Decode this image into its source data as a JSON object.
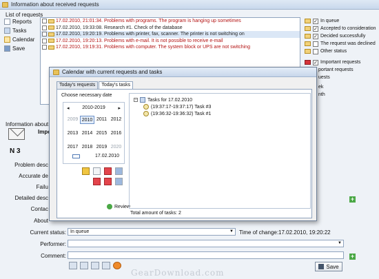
{
  "window": {
    "title": "Information about received requests"
  },
  "list": {
    "label": "List of requests",
    "rows": [
      {
        "text": "17.02.2010, 21:01:34. Problems with programs. The program is hanging up sometimes",
        "dark": false
      },
      {
        "text": "17.02.2010, 19:33:08. Research #1. Check of the database",
        "dark": true
      },
      {
        "text": "17.02.2010, 19:20:19. Problems with printer, fax, scanner. The printer is not switching on",
        "dark": true
      },
      {
        "text": "17.02.2010, 19:20:13. Problems with e-mail. It is not possible to receive e-mail",
        "dark": false
      },
      {
        "text": "17.02.2010, 19:19:31. Problems with computer. The system block or UPS are not switching",
        "dark": false
      }
    ]
  },
  "sidebar": {
    "items": [
      {
        "label": "Reports"
      },
      {
        "label": "Tasks"
      },
      {
        "label": "Calendar"
      },
      {
        "label": "Save"
      }
    ]
  },
  "filters": {
    "items": [
      {
        "label": "In queue",
        "checked": "✓"
      },
      {
        "label": "Accepted to consideration",
        "checked": "✓"
      },
      {
        "label": "Decided successfully",
        "checked": "✓"
      },
      {
        "label": "The request was declined",
        "checked": ""
      },
      {
        "label": "Other status",
        "checked": ""
      }
    ],
    "important": "Important requests",
    "fragments": [
      "portant requests",
      "uests",
      "ek",
      "nth"
    ]
  },
  "info": {
    "label": "Information about requ",
    "important": "Impor",
    "number": "N 3"
  },
  "form": {
    "labels": [
      "Problem desc",
      "Accurate de",
      "Failu",
      "Detailed desc",
      "Contac",
      "About",
      "Current status:",
      "Performer:",
      "Comment:"
    ],
    "status_value": "In queue",
    "time_label": "Time of change:",
    "time_value": "17.02.2010, 19:20:22",
    "save": "Save"
  },
  "dialog": {
    "title": "Calendar with current requests and tasks",
    "tabs": [
      "Today's requests",
      "Today's tasks"
    ],
    "choose_label": "Choose necessary date",
    "decade": "2010-2019",
    "prev": "◂",
    "next": "▸",
    "years": [
      {
        "y": "2009",
        "cls": "dim"
      },
      {
        "y": "2010",
        "cls": "sel"
      },
      {
        "y": "2011",
        "cls": ""
      },
      {
        "y": "2012",
        "cls": ""
      },
      {
        "y": "2013",
        "cls": ""
      },
      {
        "y": "2014",
        "cls": ""
      },
      {
        "y": "2015",
        "cls": ""
      },
      {
        "y": "2016",
        "cls": ""
      },
      {
        "y": "2017",
        "cls": ""
      },
      {
        "y": "2018",
        "cls": ""
      },
      {
        "y": "2019",
        "cls": ""
      },
      {
        "y": "2020",
        "cls": "dim"
      }
    ],
    "today_date": "17.02.2010",
    "review": "Review",
    "tree_root": "Tasks for 17.02.2010",
    "tree_items": [
      "(19:37:17-19:37:17) Task #3",
      "(19:36:32-19:36:32) Task #1"
    ],
    "total": "Total amount of tasks: 2"
  },
  "watermark": "GearDownload.com"
}
